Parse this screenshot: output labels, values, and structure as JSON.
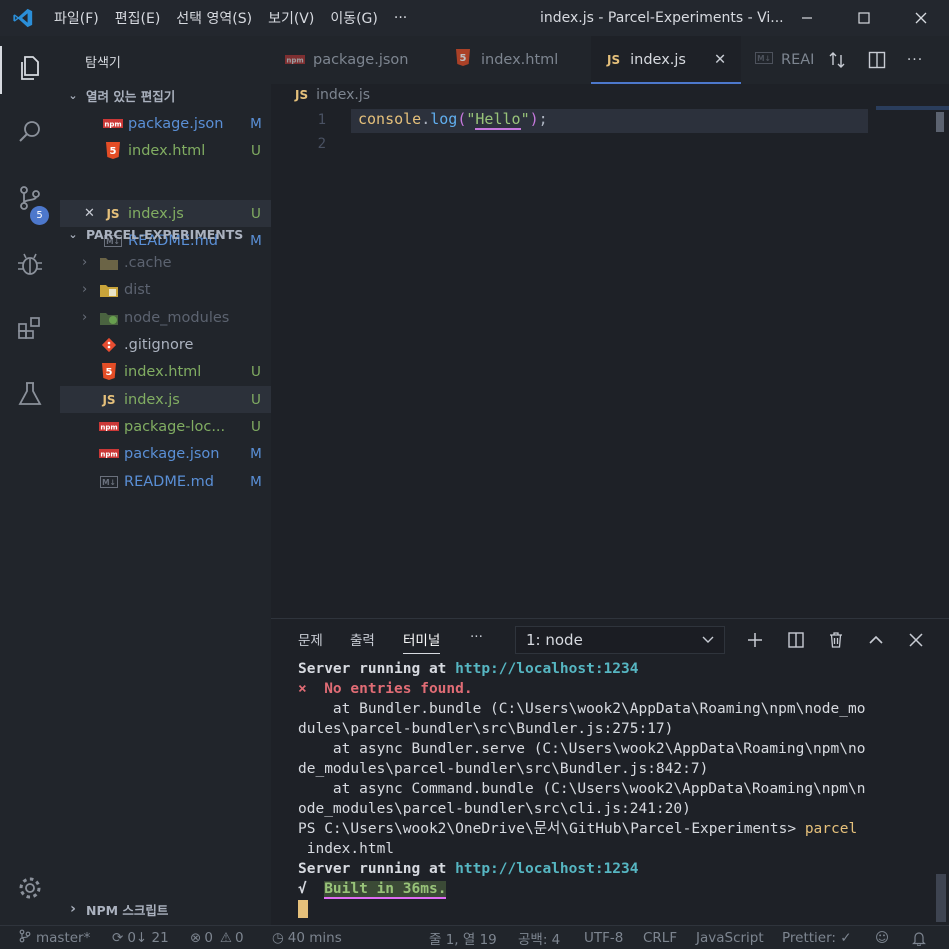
{
  "window": {
    "title": "index.js - Parcel-Experiments - Vi...",
    "menu": [
      "파일(F)",
      "편집(E)",
      "선택 영역(S)",
      "보기(V)",
      "이동(G)",
      "···"
    ]
  },
  "activity": {
    "scm_badge": "5"
  },
  "sidebar": {
    "title": "탐색기",
    "open_editors_label": "열려 있는 편집기",
    "open_editors": [
      {
        "name": "package.json",
        "status": "M",
        "icon": "npm"
      },
      {
        "name": "index.html",
        "status": "U",
        "icon": "html"
      },
      {
        "name": "index.js",
        "status": "U",
        "icon": "js",
        "close": "✕"
      },
      {
        "name": "README.md",
        "status": "M",
        "icon": "md"
      }
    ],
    "project_label": "PARCEL-EXPERIMENTS",
    "files": [
      {
        "name": ".cache",
        "status": "",
        "icon": "folder"
      },
      {
        "name": "dist",
        "status": "",
        "icon": "folder"
      },
      {
        "name": "node_modules",
        "status": "",
        "icon": "folder-node"
      },
      {
        "name": ".gitignore",
        "status": "",
        "icon": "git"
      },
      {
        "name": "index.html",
        "status": "U",
        "icon": "html"
      },
      {
        "name": "index.js",
        "status": "U",
        "icon": "js"
      },
      {
        "name": "package-loc...",
        "status": "U",
        "icon": "npm"
      },
      {
        "name": "package.json",
        "status": "M",
        "icon": "npm"
      },
      {
        "name": "README.md",
        "status": "M",
        "icon": "md"
      }
    ],
    "npm_scripts_label": "NPM 스크립트"
  },
  "tabs": [
    {
      "label": "package.json"
    },
    {
      "label": "index.html"
    },
    {
      "label": "index.js",
      "close": "✕"
    },
    {
      "label": "REAI"
    }
  ],
  "breadcrumb": {
    "icon": "JS",
    "file": "index.js"
  },
  "editor": {
    "line_numbers": [
      "1",
      "2"
    ],
    "code": {
      "obj": "console",
      "dot": ".",
      "fn": "log",
      "open": "(",
      "q1": "\"",
      "str": "Hello",
      "q2": "\"",
      "close": ")",
      "semi": ";"
    }
  },
  "panel": {
    "tabs": [
      "문제",
      "출력",
      "터미널",
      "···"
    ],
    "terminal_select": "1: node",
    "lines": [
      {
        "a": "Server running at ",
        "b": "http://localhost:1234"
      },
      {
        "err": "×  No entries found."
      },
      {
        "t": "    at Bundler.bundle (C:\\Users\\wook2\\AppData\\Roaming\\npm\\node_mo"
      },
      {
        "t": "dules\\parcel-bundler\\src\\Bundler.js:275:17)"
      },
      {
        "t": "    at async Bundler.serve (C:\\Users\\wook2\\AppData\\Roaming\\npm\\no"
      },
      {
        "t": "de_modules\\parcel-bundler\\src\\Bundler.js:842:7)"
      },
      {
        "t": "    at async Command.bundle (C:\\Users\\wook2\\AppData\\Roaming\\npm\\n"
      },
      {
        "t": "ode_modules\\parcel-bundler\\src\\cli.js:241:20)"
      },
      {
        "ps": "PS C:\\Users\\wook2\\OneDrive\\문서\\GitHub\\Parcel-Experiments> ",
        "cmd": "parcel"
      },
      {
        "t": " index.html"
      },
      {
        "a": "Server running at ",
        "b": "http://localhost:1234"
      },
      {
        "check": "√  ",
        "ok": "Built in 36ms."
      }
    ]
  },
  "status": {
    "branch": "master*",
    "sync": "0↓ 21",
    "errors": "0",
    "warnings": "0",
    "time": "40 mins",
    "position": "줄 1, 열 19",
    "spaces": "공백: 4",
    "encoding": "UTF-8",
    "eol": "CRLF",
    "language": "JavaScript",
    "prettier": "Prettier: ✓"
  },
  "colors": {
    "accent": "#4d78cc",
    "modified": "#5a8fd6",
    "untracked": "#81ad62"
  }
}
